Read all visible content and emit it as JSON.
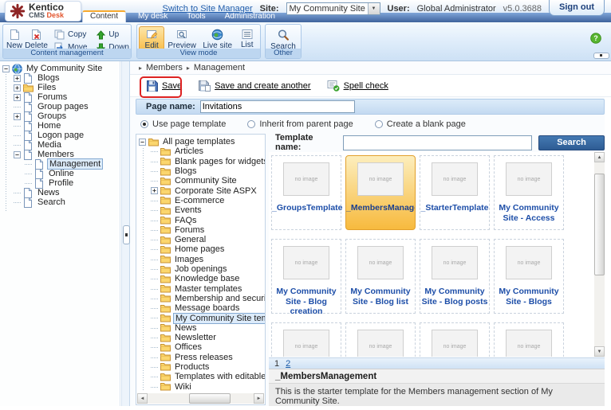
{
  "header": {
    "brand": "Kentico",
    "product_cms": "CMS",
    "product_desk": "Desk",
    "switch_link": "Switch to Site Manager",
    "site_label": "Site:",
    "site_value": "My Community Site",
    "user_label": "User:",
    "user_value": "Global Administrator",
    "version": "v5.0.3688",
    "sign_out": "Sign out",
    "tabs": [
      {
        "label": "Content",
        "active": true
      },
      {
        "label": "My desk",
        "active": false
      },
      {
        "label": "Tools",
        "active": false
      },
      {
        "label": "Administration",
        "active": false
      }
    ]
  },
  "toolbar": {
    "buttons": {
      "new": "New",
      "delete": "Delete",
      "copy": "Copy",
      "move": "Move",
      "up": "Up",
      "down": "Down",
      "edit": "Edit",
      "preview": "Preview",
      "live_site": "Live site",
      "list": "List",
      "search": "Search"
    },
    "group_labels": {
      "content_management": "Content management",
      "view_mode": "View mode",
      "other": "Other"
    }
  },
  "breadcrumb": {
    "items": [
      "Members",
      "Management"
    ]
  },
  "actions": {
    "save": "Save",
    "save_and_create": "Save and create another",
    "spell_check": "Spell check"
  },
  "form": {
    "page_name_label": "Page name:",
    "page_name_value": "Invitations",
    "radio_options": [
      {
        "label": "Use page template",
        "selected": true
      },
      {
        "label": "Inherit from parent page",
        "selected": false
      },
      {
        "label": "Create a blank page",
        "selected": false
      }
    ]
  },
  "content_tree": [
    {
      "label": "My Community Site",
      "level": 0,
      "expander": "minus",
      "icon": "site",
      "selected": false
    },
    {
      "label": "Blogs",
      "level": 1,
      "expander": "plus",
      "icon": "page",
      "selected": false
    },
    {
      "label": "Files",
      "level": 1,
      "expander": "plus",
      "icon": "folder",
      "selected": false
    },
    {
      "label": "Forums",
      "level": 1,
      "expander": "plus",
      "icon": "page",
      "selected": false
    },
    {
      "label": "Group pages",
      "level": 1,
      "expander": "none",
      "icon": "page",
      "selected": false
    },
    {
      "label": "Groups",
      "level": 1,
      "expander": "plus",
      "icon": "page",
      "selected": false
    },
    {
      "label": "Home",
      "level": 1,
      "expander": "none",
      "icon": "page",
      "selected": false
    },
    {
      "label": "Logon page",
      "level": 1,
      "expander": "none",
      "icon": "page",
      "selected": false
    },
    {
      "label": "Media",
      "level": 1,
      "expander": "none",
      "icon": "page",
      "selected": false
    },
    {
      "label": "Members",
      "level": 1,
      "expander": "minus",
      "icon": "page",
      "selected": false
    },
    {
      "label": "Management",
      "level": 2,
      "expander": "none",
      "icon": "page",
      "selected": true
    },
    {
      "label": "Online",
      "level": 2,
      "expander": "none",
      "icon": "page",
      "selected": false
    },
    {
      "label": "Profile",
      "level": 2,
      "expander": "none",
      "icon": "page",
      "selected": false
    },
    {
      "label": "News",
      "level": 1,
      "expander": "none",
      "icon": "page",
      "selected": false
    },
    {
      "label": "Search",
      "level": 1,
      "expander": "none",
      "icon": "page",
      "selected": false
    }
  ],
  "template_selector": {
    "tree": [
      {
        "label": "All page templates",
        "level": 0,
        "expander": "minus",
        "icon": "folder",
        "selected": false
      },
      {
        "label": "Articles",
        "level": 1,
        "expander": "none",
        "icon": "folder",
        "selected": false
      },
      {
        "label": "Blank pages for widgets",
        "level": 1,
        "expander": "none",
        "icon": "folder",
        "selected": false
      },
      {
        "label": "Blogs",
        "level": 1,
        "expander": "none",
        "icon": "folder",
        "selected": false
      },
      {
        "label": "Community Site",
        "level": 1,
        "expander": "none",
        "icon": "folder",
        "selected": false
      },
      {
        "label": "Corporate Site ASPX",
        "level": 1,
        "expander": "plus",
        "icon": "folder",
        "selected": false
      },
      {
        "label": "E-commerce",
        "level": 1,
        "expander": "none",
        "icon": "folder",
        "selected": false
      },
      {
        "label": "Events",
        "level": 1,
        "expander": "none",
        "icon": "folder",
        "selected": false
      },
      {
        "label": "FAQs",
        "level": 1,
        "expander": "none",
        "icon": "folder",
        "selected": false
      },
      {
        "label": "Forums",
        "level": 1,
        "expander": "none",
        "icon": "folder",
        "selected": false
      },
      {
        "label": "General",
        "level": 1,
        "expander": "none",
        "icon": "folder",
        "selected": false
      },
      {
        "label": "Home pages",
        "level": 1,
        "expander": "none",
        "icon": "folder",
        "selected": false
      },
      {
        "label": "Images",
        "level": 1,
        "expander": "none",
        "icon": "folder",
        "selected": false
      },
      {
        "label": "Job openings",
        "level": 1,
        "expander": "none",
        "icon": "folder",
        "selected": false
      },
      {
        "label": "Knowledge base",
        "level": 1,
        "expander": "none",
        "icon": "folder",
        "selected": false
      },
      {
        "label": "Master templates",
        "level": 1,
        "expander": "none",
        "icon": "folder",
        "selected": false
      },
      {
        "label": "Membership and security",
        "level": 1,
        "expander": "none",
        "icon": "folder",
        "selected": false
      },
      {
        "label": "Message boards",
        "level": 1,
        "expander": "none",
        "icon": "folder",
        "selected": false
      },
      {
        "label": "My Community Site templates",
        "level": 1,
        "expander": "none",
        "icon": "folder",
        "selected": true
      },
      {
        "label": "News",
        "level": 1,
        "expander": "none",
        "icon": "folder",
        "selected": false
      },
      {
        "label": "Newsletter",
        "level": 1,
        "expander": "none",
        "icon": "folder",
        "selected": false
      },
      {
        "label": "Offices",
        "level": 1,
        "expander": "none",
        "icon": "folder",
        "selected": false
      },
      {
        "label": "Press releases",
        "level": 1,
        "expander": "none",
        "icon": "folder",
        "selected": false
      },
      {
        "label": "Products",
        "level": 1,
        "expander": "none",
        "icon": "folder",
        "selected": false
      },
      {
        "label": "Templates with editable regio",
        "level": 1,
        "expander": "none",
        "icon": "folder",
        "selected": false
      },
      {
        "label": "Wiki",
        "level": 1,
        "expander": "none",
        "icon": "folder",
        "selected": false
      }
    ],
    "search_label": "Template name:",
    "search_value": "",
    "search_button": "Search",
    "no_image_text": "no image",
    "templates": [
      {
        "label": "_GroupsTemplate",
        "selected": false
      },
      {
        "label": "_MembersManagement",
        "selected": true
      },
      {
        "label": "_StarterTemplate",
        "selected": false
      },
      {
        "label": "My Community Site - Access",
        "selected": false
      },
      {
        "label": "My Community Site - Blog creation",
        "selected": false
      },
      {
        "label": "My Community Site - Blog list",
        "selected": false
      },
      {
        "label": "My Community Site - Blog posts",
        "selected": false
      },
      {
        "label": "My Community Site - Blogs",
        "selected": false
      },
      {
        "label": "",
        "selected": false
      },
      {
        "label": "",
        "selected": false
      },
      {
        "label": "",
        "selected": false
      },
      {
        "label": "",
        "selected": false
      }
    ],
    "pagination": [
      {
        "label": "1",
        "current": true
      },
      {
        "label": "2",
        "current": false
      }
    ],
    "selected_info": {
      "title": "_MembersManagement",
      "description": "This is the starter template for the Members management section of My Community Site."
    }
  },
  "colors": {
    "brand_red": "#8e2424",
    "accent_orange": "#f8bb44",
    "selected_template_orange": "#f6b93d",
    "link_blue": "#1d5da8",
    "search_button_blue": "#2e5c94",
    "annotation_red": "#dd2222"
  }
}
